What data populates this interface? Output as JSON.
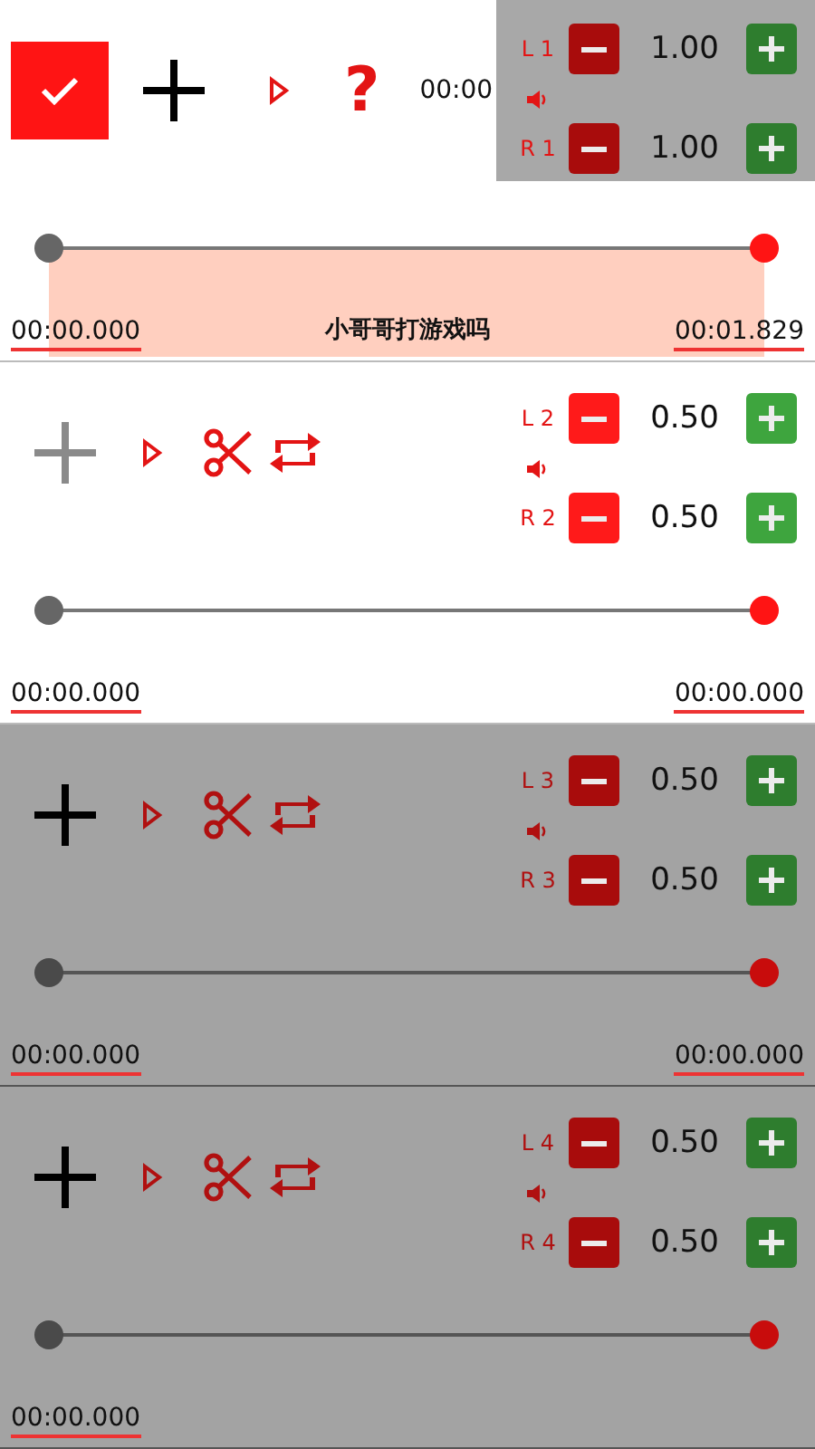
{
  "tracks": [
    {
      "kind": "main",
      "selected": true,
      "dimmed": false,
      "add_disabled": false,
      "help": "?",
      "clock": "00:00",
      "name": "小哥哥打游戏吗",
      "start_time": "00:00.000",
      "end_time": "00:01.829",
      "left": {
        "label": "L 1",
        "value": "1.00"
      },
      "right": {
        "label": "R 1",
        "value": "1.00"
      }
    },
    {
      "kind": "clip",
      "selected": false,
      "dimmed": false,
      "add_disabled": true,
      "start_time": "00:00.000",
      "end_time": "00:00.000",
      "left": {
        "label": "L 2",
        "value": "0.50"
      },
      "right": {
        "label": "R 2",
        "value": "0.50"
      }
    },
    {
      "kind": "clip",
      "selected": false,
      "dimmed": true,
      "add_disabled": false,
      "start_time": "00:00.000",
      "end_time": "00:00.000",
      "left": {
        "label": "L 3",
        "value": "0.50"
      },
      "right": {
        "label": "R 3",
        "value": "0.50"
      }
    },
    {
      "kind": "clip",
      "selected": false,
      "dimmed": true,
      "add_disabled": false,
      "start_time": "00:00.000",
      "left": {
        "label": "L 4",
        "value": "0.50"
      },
      "right": {
        "label": "R 4",
        "value": "0.50"
      }
    }
  ]
}
